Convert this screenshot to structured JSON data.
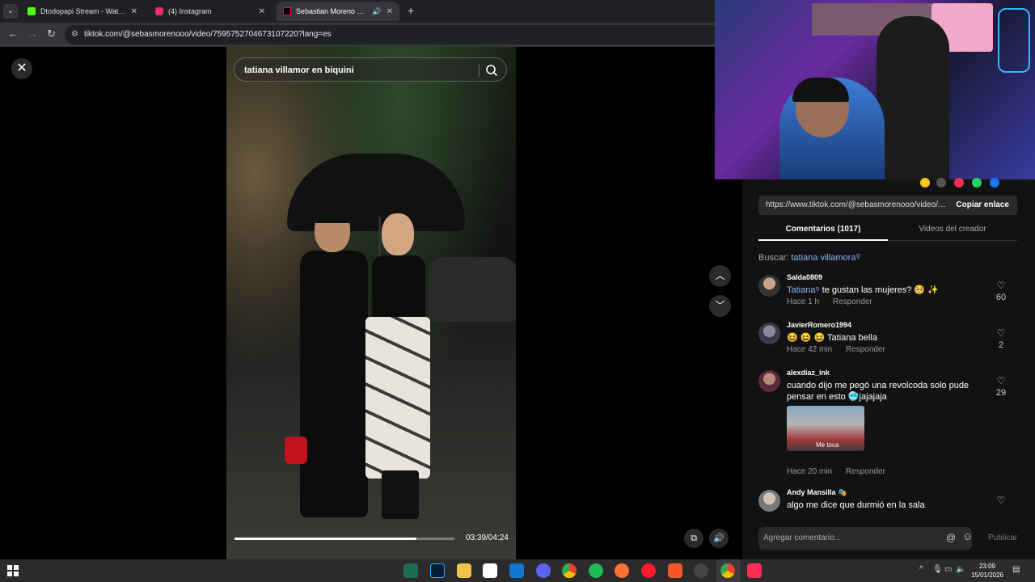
{
  "browser": {
    "tabs": [
      {
        "title": "Dtodopapi Stream - Watch Live",
        "active": false,
        "favicon_color": "#53fc18"
      },
      {
        "title": "(4) Instagram",
        "active": false,
        "favicon_color": "#e1306c"
      },
      {
        "title": "Sebastian Moreno ☂ (@se",
        "active": true,
        "favicon_color": "#000000"
      }
    ],
    "url": "tiktok.com/@sebasmorenooo/video/7595752704673107220?lang=es"
  },
  "video": {
    "search_query": "tatiana villamor en biquini",
    "current_time": "03:39",
    "duration": "04:24",
    "time_display": "03:39/04:24",
    "progress_fraction": 0.828
  },
  "panel": {
    "link": "https://www.tiktok.com/@sebasmorenooo/video/7...",
    "copy_label": "Copiar enlace",
    "tab_comments": "Comentarios (1017)",
    "tab_creator": "Videos del creador",
    "search_label": "Buscar:",
    "search_term": "tatiana villamora",
    "comments": [
      {
        "user": "Salda0809",
        "mention": "Tatiana",
        "text": " te gustan las mujeres? 🥺 ✨",
        "time": "Hace 1 h",
        "reply": "Responder",
        "likes": "60"
      },
      {
        "user": "JavierRomero1994",
        "mention": "",
        "text": "😆 😆 😆 Tatiana bella",
        "time": "Hace 42 min",
        "reply": "Responder",
        "likes": "2"
      },
      {
        "user": "alexdiaz_ink",
        "mention": "",
        "text": "cuando dijo me pegó una revolcoda solo pude pensar en esto 🥶jajajaja",
        "time": "Hace 20 min",
        "reply": "Responder",
        "likes": "29",
        "gif_caption": "Me toca"
      },
      {
        "user": "Andy Mansilla 🎭",
        "mention": "",
        "text": "algo me dice que durmió en la sala",
        "time": "",
        "reply": "",
        "likes": ""
      }
    ],
    "composer_placeholder": "Agregar comentario...",
    "publish_label": "Publicar"
  },
  "taskbar": {
    "time": "23:09",
    "date": "15/01/2026"
  },
  "colors": {
    "link_blue": "#8ab4f8",
    "panel_bg": "#121212",
    "taskbar_bg": "#2b2b2b"
  }
}
